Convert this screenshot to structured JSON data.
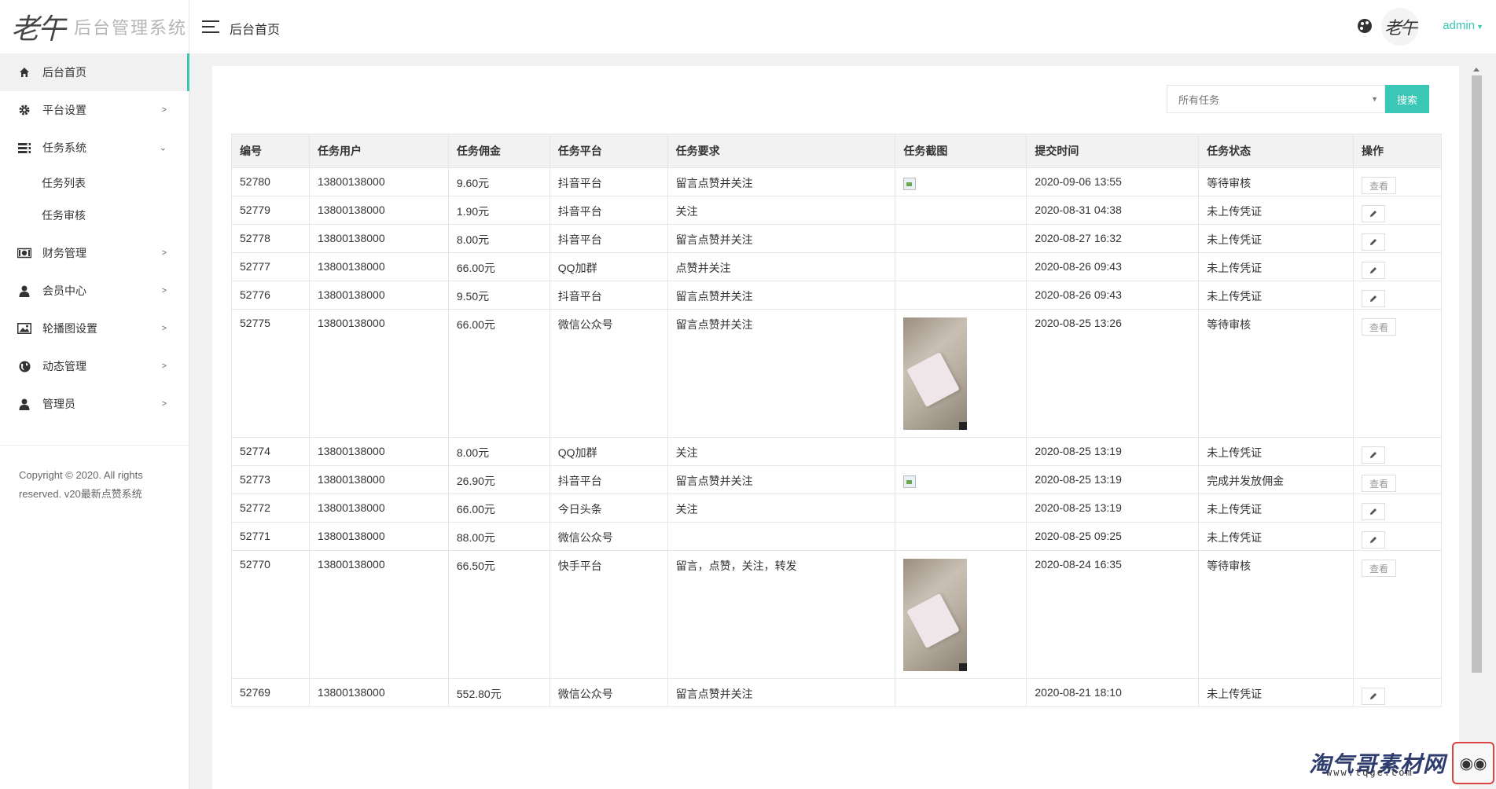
{
  "brand": {
    "mark": "老午",
    "title": "后台管理系统"
  },
  "sidebar": {
    "items": [
      {
        "label": "后台首页",
        "icon": "home-icon"
      },
      {
        "label": "平台设置",
        "icon": "gear-icon"
      },
      {
        "label": "任务系统",
        "icon": "tasks-icon",
        "sub": [
          "任务列表",
          "任务审核"
        ]
      },
      {
        "label": "财务管理",
        "icon": "money-icon"
      },
      {
        "label": "会员中心",
        "icon": "user-icon"
      },
      {
        "label": "轮播图设置",
        "icon": "image-icon"
      },
      {
        "label": "动态管理",
        "icon": "globe-icon"
      },
      {
        "label": "管理员",
        "icon": "user-icon"
      }
    ],
    "copyright": "Copyright © 2020. All rights reserved. v20最新点赞系统"
  },
  "header": {
    "title": "后台首页",
    "avatar": "老午",
    "user": "admin"
  },
  "search": {
    "select_value": "所有任务",
    "button": "搜索"
  },
  "table": {
    "headers": [
      "编号",
      "任务用户",
      "任务佣金",
      "任务平台",
      "任务要求",
      "任务截图",
      "提交时间",
      "任务状态",
      "操作"
    ],
    "rows": [
      {
        "id": "52780",
        "user": "13800138000",
        "fee": "9.60元",
        "platform": "抖音平台",
        "req": "留言点赞并关注",
        "shot": "broken",
        "time": "2020-09-06 13:55",
        "status": "等待审核",
        "op": "查看"
      },
      {
        "id": "52779",
        "user": "13800138000",
        "fee": "1.90元",
        "platform": "抖音平台",
        "req": "关注",
        "shot": "none",
        "time": "2020-08-31 04:38",
        "status": "未上传凭证",
        "op": "edit"
      },
      {
        "id": "52778",
        "user": "13800138000",
        "fee": "8.00元",
        "platform": "抖音平台",
        "req": "留言点赞并关注",
        "shot": "none",
        "time": "2020-08-27 16:32",
        "status": "未上传凭证",
        "op": "edit"
      },
      {
        "id": "52777",
        "user": "13800138000",
        "fee": "66.00元",
        "platform": "QQ加群",
        "req": "点赞并关注",
        "shot": "none",
        "time": "2020-08-26 09:43",
        "status": "未上传凭证",
        "op": "edit"
      },
      {
        "id": "52776",
        "user": "13800138000",
        "fee": "9.50元",
        "platform": "抖音平台",
        "req": "留言点赞并关注",
        "shot": "none",
        "time": "2020-08-26 09:43",
        "status": "未上传凭证",
        "op": "edit"
      },
      {
        "id": "52775",
        "user": "13800138000",
        "fee": "66.00元",
        "platform": "微信公众号",
        "req": "留言点赞并关注",
        "shot": "photo",
        "time": "2020-08-25 13:26",
        "status": "等待审核",
        "op": "查看"
      },
      {
        "id": "52774",
        "user": "13800138000",
        "fee": "8.00元",
        "platform": "QQ加群",
        "req": "关注",
        "shot": "none",
        "time": "2020-08-25 13:19",
        "status": "未上传凭证",
        "op": "edit"
      },
      {
        "id": "52773",
        "user": "13800138000",
        "fee": "26.90元",
        "platform": "抖音平台",
        "req": "留言点赞并关注",
        "shot": "broken",
        "time": "2020-08-25 13:19",
        "status": "完成并发放佣金",
        "op": "查看"
      },
      {
        "id": "52772",
        "user": "13800138000",
        "fee": "66.00元",
        "platform": "今日头条",
        "req": "关注",
        "shot": "none",
        "time": "2020-08-25 13:19",
        "status": "未上传凭证",
        "op": "edit"
      },
      {
        "id": "52771",
        "user": "13800138000",
        "fee": "88.00元",
        "platform": "微信公众号",
        "req": "",
        "shot": "none",
        "time": "2020-08-25 09:25",
        "status": "未上传凭证",
        "op": "edit"
      },
      {
        "id": "52770",
        "user": "13800138000",
        "fee": "66.50元",
        "platform": "快手平台",
        "req": "留言，点赞，关注，转发",
        "shot": "photo",
        "time": "2020-08-24 16:35",
        "status": "等待审核",
        "op": "查看"
      },
      {
        "id": "52769",
        "user": "13800138000",
        "fee": "552.80元",
        "platform": "微信公众号",
        "req": "留言点赞并关注",
        "shot": "none",
        "time": "2020-08-21 18:10",
        "status": "未上传凭证",
        "op": "edit"
      }
    ]
  },
  "watermark": {
    "text": "淘气哥素材网",
    "sub": "www.tqge.com"
  },
  "colors": {
    "accent": "#3ac7b6",
    "header_bg": "#f2f2f2"
  }
}
